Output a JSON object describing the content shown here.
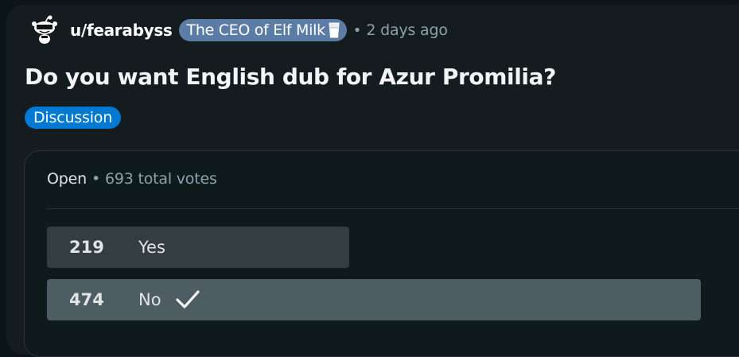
{
  "post": {
    "username": "u/fearabyss",
    "flair": "The CEO of Elf Milk",
    "flair_emoji": "milk-glass-icon",
    "time_separator": "•",
    "time": "2 days ago",
    "title": "Do you want English dub for Azur Promilia?",
    "tag": "Discussion"
  },
  "poll": {
    "status": "Open",
    "separator": "•",
    "total_votes": "693 total votes",
    "options": [
      {
        "count": "219",
        "label": "Yes",
        "share": 0.316,
        "selected": false
      },
      {
        "count": "474",
        "label": "No",
        "share": 0.684,
        "selected": true
      }
    ]
  },
  "colors": {
    "page_bg": "#0b1416",
    "card_bg": "#141c1f",
    "flair_bg": "#5b7ca5",
    "tag_bg": "#0079d3",
    "option_bg": "#343d42",
    "option_winner_bg": "#4e5c64",
    "muted_text": "#8ba2ad"
  }
}
